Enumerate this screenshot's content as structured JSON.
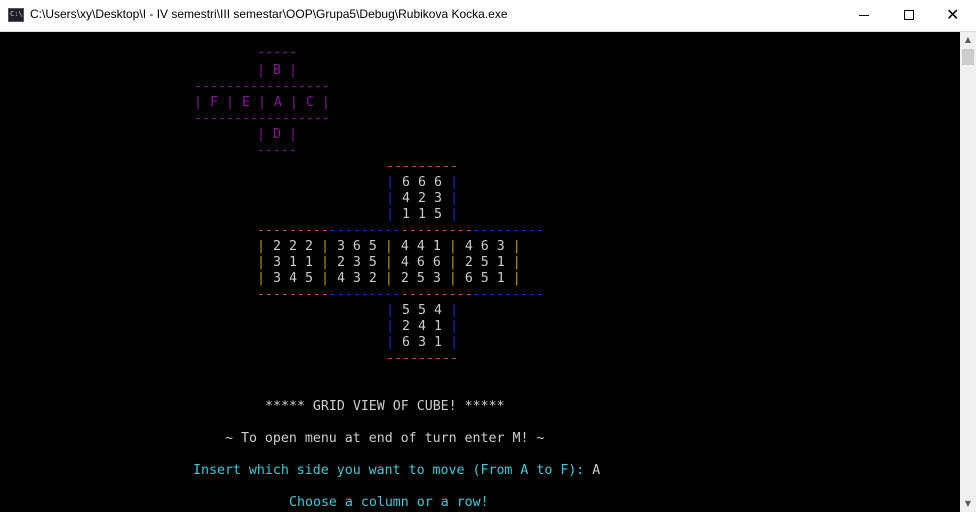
{
  "window": {
    "title": "C:\\Users\\xy\\Desktop\\I - IV semestri\\III semestar\\OOP\\Grupa5\\Debug\\Rubikova Kocka.exe",
    "min_icon": "minimize-icon",
    "max_icon": "maximize-icon",
    "close_icon": "close-icon"
  },
  "layout_legend": {
    "top": "B",
    "middle": [
      "F",
      "E",
      "A",
      "C"
    ],
    "bottom": "D"
  },
  "cube": {
    "top_face": [
      "6 6 6",
      "4 2 3",
      "1 1 5"
    ],
    "middle_rows": [
      [
        "2 2 2",
        "3 6 5",
        "4 4 1",
        "4 6 3"
      ],
      [
        "3 1 1",
        "2 3 5",
        "4 6 6",
        "2 5 1"
      ],
      [
        "3 4 5",
        "4 3 2",
        "2 5 3",
        "6 5 1"
      ]
    ],
    "bottom_face": [
      "5 5 4",
      "2 4 1",
      "6 3 1"
    ]
  },
  "messages": {
    "grid_title": "***** GRID VIEW OF CUBE! *****",
    "menu_hint": "~ To open menu at end of turn enter M! ~",
    "prompt": "Insert which side you want to move (From A to F): ",
    "prompt_answer": "A",
    "choose": "Choose a column or a row!"
  },
  "colors": {
    "legend": "#881798",
    "border_red": "#e74856",
    "border_blue": "#0037da",
    "border_yellow": "#c19c00",
    "digits": "#cccccc",
    "prompt": "#3acdd9"
  }
}
